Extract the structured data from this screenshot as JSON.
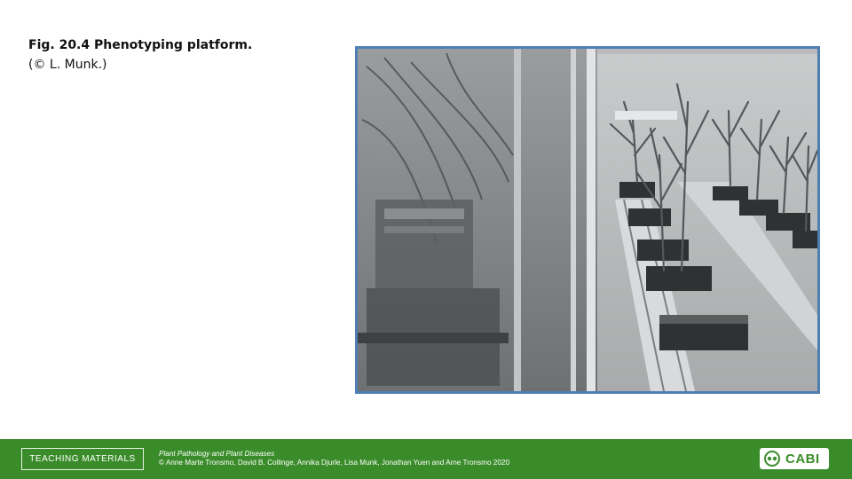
{
  "caption": {
    "title": "Fig. 20.4 Phenotyping platform.",
    "credit": "(© L. Munk.)"
  },
  "photo": {
    "subject": "phenotyping-platform-photo",
    "frame_color": "#4f7fb2"
  },
  "footer": {
    "teaching_label": "TEACHING MATERIALS",
    "book_title": "Plant Pathology and Plant Diseases",
    "authors": "© Anne Marte Tronsmo, David B. Collinge, Annika Djurle, Lisa Munk, Jonathan Yuen and Arne Tronsmo 2020",
    "logo_text": "CABI",
    "bar_color": "#3a8c2a"
  }
}
